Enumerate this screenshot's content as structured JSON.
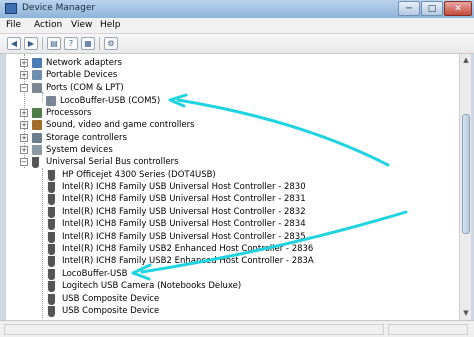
{
  "window": {
    "title": "Device Manager"
  },
  "title_buttons": {
    "minimize": "─",
    "maximize": "□",
    "close": "✕"
  },
  "menu": [
    "File",
    "Action",
    "View",
    "Help"
  ],
  "toolbar": [
    "back-icon",
    "forward-icon",
    "properties-icon",
    "show-hidden-icon",
    "help-icon",
    "scan-hardware-icon"
  ],
  "tree": [
    {
      "label": "Network adapters",
      "expander": "+",
      "icon": "network-icon"
    },
    {
      "label": "Portable Devices",
      "expander": "+",
      "icon": "portable-device-icon"
    },
    {
      "label": "Ports (COM & LPT)",
      "expander": "−",
      "icon": "port-icon"
    },
    {
      "label": "LocoBuffer-USB (COM5)",
      "icon": "port-device-icon"
    },
    {
      "label": "Processors",
      "expander": "+",
      "icon": "processor-icon"
    },
    {
      "label": "Sound, video and game controllers",
      "expander": "+",
      "icon": "sound-icon"
    },
    {
      "label": "Storage controllers",
      "expander": "+",
      "icon": "storage-icon"
    },
    {
      "label": "System devices",
      "expander": "+",
      "icon": "system-device-icon"
    },
    {
      "label": "Universal Serial Bus controllers",
      "expander": "−",
      "icon": "usb-icon"
    },
    {
      "label": "HP Officejet 4300 Series (DOT4USB)",
      "icon": "usb-device-icon"
    },
    {
      "label": "Intel(R) ICH8 Family USB Universal Host Controller - 2830",
      "icon": "usb-device-icon"
    },
    {
      "label": "Intel(R) ICH8 Family USB Universal Host Controller - 2831",
      "icon": "usb-device-icon"
    },
    {
      "label": "Intel(R) ICH8 Family USB Universal Host Controller - 2832",
      "icon": "usb-device-icon"
    },
    {
      "label": "Intel(R) ICH8 Family USB Universal Host Controller - 2834",
      "icon": "usb-device-icon"
    },
    {
      "label": "Intel(R) ICH8 Family USB Universal Host Controller - 2835",
      "icon": "usb-device-icon"
    },
    {
      "label": "Intel(R) ICH8 Family USB2 Enhanced Host Controller - 2836",
      "icon": "usb-device-icon"
    },
    {
      "label": "Intel(R) ICH8 Family USB2 Enhanced Host Controller - 283A",
      "icon": "usb-device-icon"
    },
    {
      "label": "LocoBuffer-USB",
      "icon": "usb-device-icon"
    },
    {
      "label": "Logitech USB Camera (Notebooks Deluxe)",
      "icon": "usb-device-icon"
    },
    {
      "label": "USB Composite Device",
      "icon": "usb-device-icon"
    },
    {
      "label": "USB Composite Device",
      "icon": "usb-device-icon"
    }
  ],
  "colors": {
    "annotation_arrow": "#1fd3df",
    "title_bar": "#a9c6e6"
  }
}
